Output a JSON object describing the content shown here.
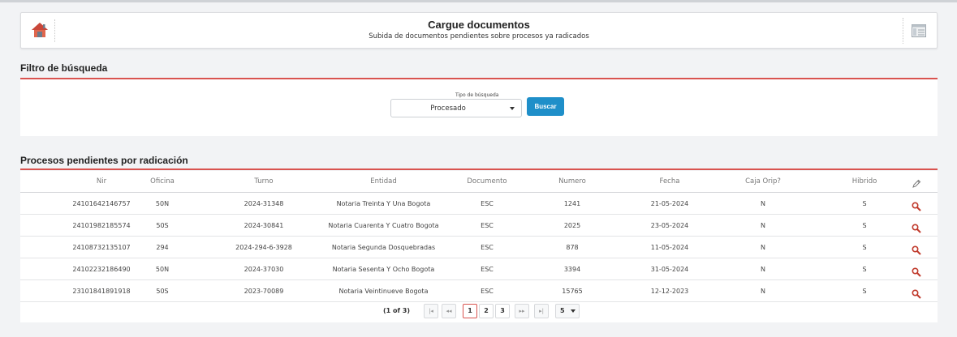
{
  "header": {
    "title": "Cargue documentos",
    "subtitle": "Subida de documentos pendientes sobre procesos ya radicados"
  },
  "filter": {
    "section_title": "Filtro de búsqueda",
    "type_label": "Tipo de búsqueda",
    "type_value": "Procesado",
    "search_button": "Buscar"
  },
  "table": {
    "section_title": "Procesos pendientes por radicación",
    "columns": [
      "Nir",
      "Oficina",
      "Turno",
      "Entidad",
      "Documento",
      "Numero",
      "Fecha",
      "Caja Orip?",
      "Hibrido"
    ],
    "rows": [
      [
        "24101642146757",
        "50N",
        "2024-31348",
        "Notaria Treinta Y Una Bogota",
        "ESC",
        "1241",
        "21-05-2024",
        "N",
        "S"
      ],
      [
        "24101982185574",
        "50S",
        "2024-30841",
        "Notaria Cuarenta Y Cuatro Bogota",
        "ESC",
        "2025",
        "23-05-2024",
        "N",
        "S"
      ],
      [
        "24108732135107",
        "294",
        "2024-294-6-3928",
        "Notaria Segunda Dosquebradas",
        "ESC",
        "878",
        "11-05-2024",
        "N",
        "S"
      ],
      [
        "24102232186490",
        "50N",
        "2024-37030",
        "Notaria Sesenta Y Ocho Bogota",
        "ESC",
        "3394",
        "31-05-2024",
        "N",
        "S"
      ],
      [
        "23101841891918",
        "50S",
        "2023-70089",
        "Notaria Veintinueve Bogota",
        "ESC",
        "15765",
        "12-12-2023",
        "N",
        "S"
      ]
    ]
  },
  "pagination": {
    "info": "(1 of 3)",
    "first": "|◂",
    "prev": "◂◂",
    "pages": [
      "1",
      "2",
      "3"
    ],
    "current_page": "1",
    "next": "▸▸",
    "last": "▸|",
    "page_size": "5"
  },
  "colors": {
    "accent_red": "#d9534f",
    "button_blue": "#1f8fc9",
    "search_icon": "#c0392b"
  },
  "icons": {
    "home": "home-icon",
    "panel": "panel-layout-icon",
    "edit": "pencil-icon",
    "row_action": "search-icon"
  }
}
